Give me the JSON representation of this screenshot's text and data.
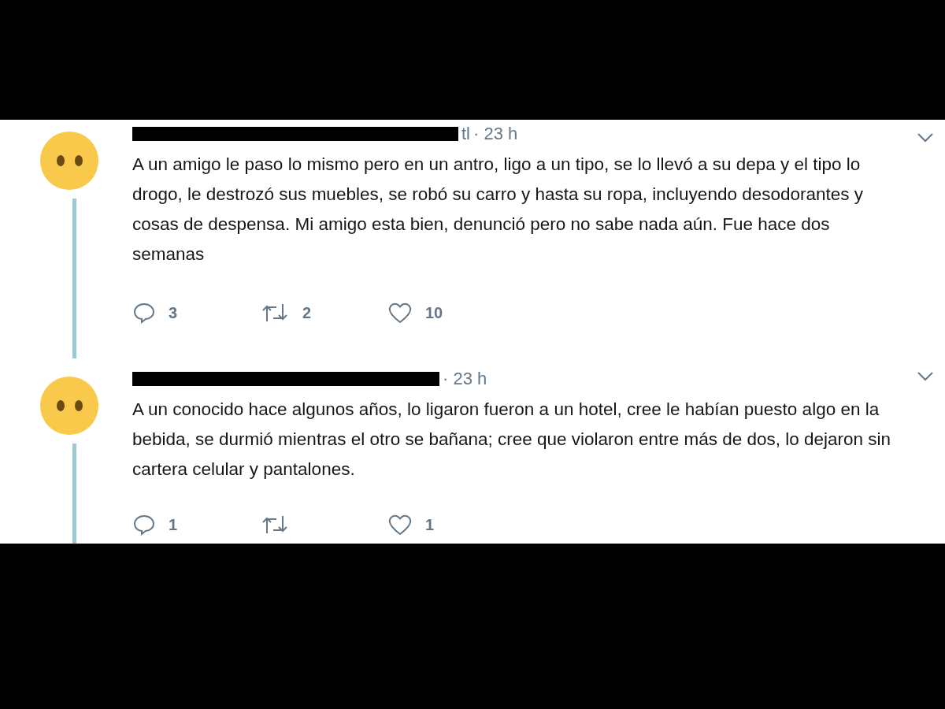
{
  "tweets": [
    {
      "handle_fragment": "tl",
      "time": "· 23 h",
      "text": "A un amigo le paso lo mismo pero en un antro, ligo a un tipo, se lo llevó a su depa y el tipo lo drogo, le destrozó sus muebles, se robó su carro y hasta su ropa, incluyendo desodorantes y cosas de despensa. Mi amigo esta bien, denunció pero no sabe nada aún. Fue hace dos semanas",
      "replies": "3",
      "retweets": "2",
      "likes": "10"
    },
    {
      "time": "· 23 h",
      "text": "A un conocido hace algunos años, lo ligaron fueron a un hotel, cree le habían puesto algo en la bebida, se durmió mientras el otro se bañana; cree que violaron entre más de dos, lo dejaron sin cartera celular y pantalones.",
      "replies": "1",
      "likes": "1"
    }
  ]
}
